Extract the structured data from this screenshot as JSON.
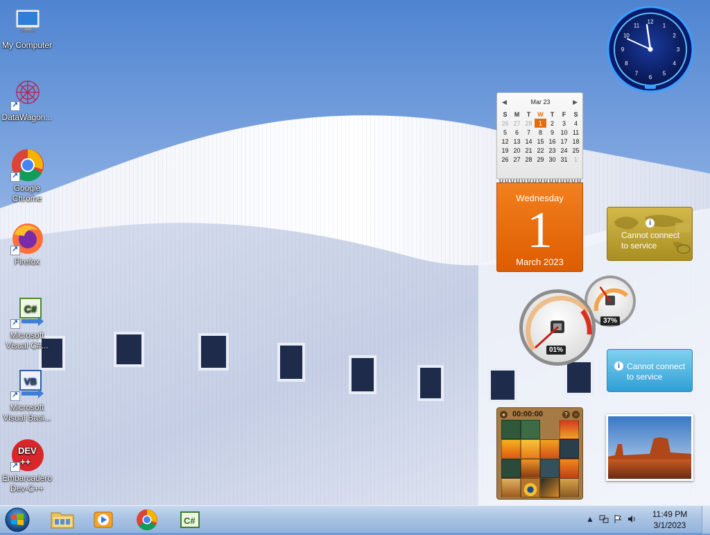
{
  "desktop": {
    "icons": [
      {
        "label": "My Computer",
        "icon": "computer-icon"
      },
      {
        "label": "DataWagon...",
        "icon": "datawagon-icon"
      },
      {
        "label": "Google Chrome",
        "icon": "chrome-icon"
      },
      {
        "label": "Firefox",
        "icon": "firefox-icon"
      },
      {
        "label": "Microsoft Visual C#...",
        "icon": "visual-csharp-icon"
      },
      {
        "label": "Microsoft Visual Basi...",
        "icon": "visual-basic-icon"
      },
      {
        "label": "Embarcadero Dev-C++",
        "icon": "devcpp-icon"
      }
    ]
  },
  "calendar": {
    "month_title": "Mar 23",
    "weekday_headers": [
      "S",
      "M",
      "T",
      "W",
      "T",
      "F",
      "S"
    ],
    "weeks": [
      [
        "26",
        "27",
        "28",
        "1",
        "2",
        "3",
        "4"
      ],
      [
        "5",
        "6",
        "7",
        "8",
        "9",
        "10",
        "11"
      ],
      [
        "12",
        "13",
        "14",
        "15",
        "16",
        "17",
        "18"
      ],
      [
        "19",
        "20",
        "21",
        "22",
        "23",
        "24",
        "25"
      ],
      [
        "26",
        "27",
        "28",
        "29",
        "30",
        "31",
        "1"
      ]
    ],
    "weekday": "Wednesday",
    "day_number": "1",
    "month_year": "March 2023",
    "accent": "#e46c0a"
  },
  "gadgets": {
    "weather_msg": "Cannot connect to service",
    "feed_msg": "Cannot connect to service",
    "cpu_value": "01%",
    "ram_value": "37%",
    "cpu_fraction": 0.01,
    "ram_fraction": 0.37,
    "puzzle_time": "00:00:00"
  },
  "clock": {
    "numerals": [
      "12",
      "1",
      "2",
      "3",
      "4",
      "5",
      "6",
      "7",
      "8",
      "9",
      "10",
      "11"
    ]
  },
  "taskbar": {
    "pinned": [
      "explorer-icon",
      "media-player-icon",
      "chrome-icon",
      "visual-csharp-icon"
    ],
    "time": "11:49 PM",
    "date": "3/1/2023"
  }
}
